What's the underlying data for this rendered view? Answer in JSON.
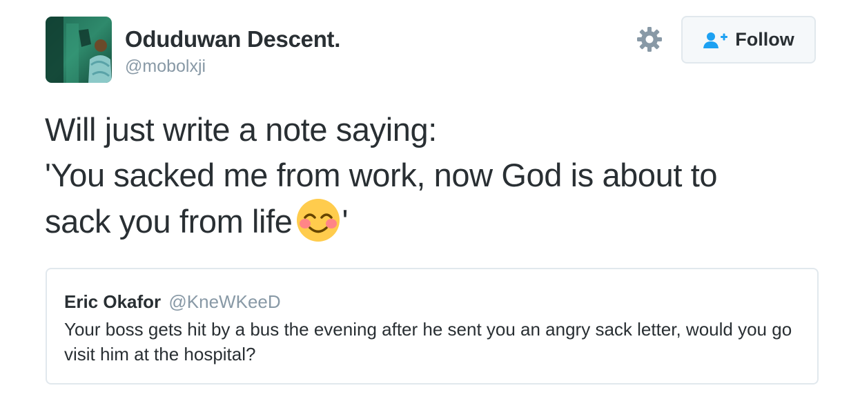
{
  "author": {
    "display_name": "Oduduwan Descent.",
    "handle": "@mobolxji",
    "avatar": "user-avatar-photo"
  },
  "actions": {
    "settings_icon": "gear-icon",
    "follow_icon": "follow-user-plus-icon",
    "follow_label": "Follow"
  },
  "tweet": {
    "lines": [
      "Will just write a note saying:",
      "'You sacked me from work, now God is about to",
      "sack you from life"
    ],
    "emoji": "smiling-face-with-blush-emoji",
    "closing_quote": "'"
  },
  "quoted_tweet": {
    "author_name": "Eric Okafor",
    "author_handle": "@KneWKeeD",
    "text": "Your boss gets hit by a bus the evening after he sent you an angry sack letter, would you go visit him at the hospital?"
  },
  "colors": {
    "text": "#292f33",
    "muted": "#8899a6",
    "border": "#e1e8ed",
    "follow_icon_blue": "#1da1f2",
    "gear": "#8899a6"
  }
}
